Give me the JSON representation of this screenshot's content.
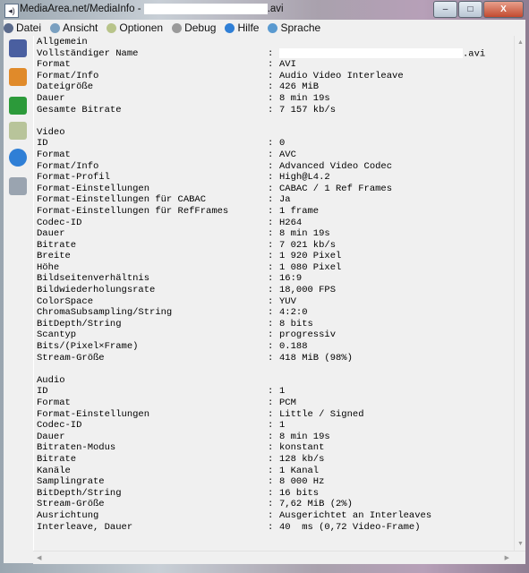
{
  "window": {
    "title_prefix": "MediaArea.net/MediaInfo - ",
    "title_suffix": ".avi",
    "minimize": "–",
    "maximize": "□",
    "close": "X"
  },
  "menu": [
    {
      "label": "Datei",
      "icon": "file-icon",
      "color": "#5b6b8c"
    },
    {
      "label": "Ansicht",
      "icon": "view-icon",
      "color": "#7aa0c0"
    },
    {
      "label": "Optionen",
      "icon": "options-icon",
      "color": "#b8c48a"
    },
    {
      "label": "Debug",
      "icon": "debug-icon",
      "color": "#9a9a9a"
    },
    {
      "label": "Hilfe",
      "icon": "info-icon",
      "color": "#2f7fd6"
    },
    {
      "label": "Sprache",
      "icon": "globe-icon",
      "color": "#5a9ad0"
    }
  ],
  "sidebar_icons": [
    "open-file-icon",
    "open-folder-icon",
    "export-icon",
    "tree-view-icon",
    "about-icon",
    "copy-icon"
  ],
  "sections": [
    {
      "title": "Allgemein",
      "rows": [
        [
          "Vollständiger Name",
          ".avi"
        ],
        [
          "Format",
          "AVI"
        ],
        [
          "Format/Info",
          "Audio Video Interleave"
        ],
        [
          "Dateigröße",
          "426 MiB"
        ],
        [
          "Dauer",
          "8 min 19s"
        ],
        [
          "Gesamte Bitrate",
          "7 157 kb/s"
        ]
      ]
    },
    {
      "title": "Video",
      "rows": [
        [
          "ID",
          "0"
        ],
        [
          "Format",
          "AVC"
        ],
        [
          "Format/Info",
          "Advanced Video Codec"
        ],
        [
          "Format-Profil",
          "High@L4.2"
        ],
        [
          "Format-Einstellungen",
          "CABAC / 1 Ref Frames"
        ],
        [
          "Format-Einstellungen für CABAC",
          "Ja"
        ],
        [
          "Format-Einstellungen für RefFrames",
          "1 frame"
        ],
        [
          "Codec-ID",
          "H264"
        ],
        [
          "Dauer",
          "8 min 19s"
        ],
        [
          "Bitrate",
          "7 021 kb/s"
        ],
        [
          "Breite",
          "1 920 Pixel"
        ],
        [
          "Höhe",
          "1 080 Pixel"
        ],
        [
          "Bildseitenverhältnis",
          "16:9"
        ],
        [
          "Bildwiederholungsrate",
          "18,000 FPS"
        ],
        [
          "ColorSpace",
          "YUV"
        ],
        [
          "ChromaSubsampling/String",
          "4:2:0"
        ],
        [
          "BitDepth/String",
          "8 bits"
        ],
        [
          "Scantyp",
          "progressiv"
        ],
        [
          "Bits/(Pixel×Frame)",
          "0.188"
        ],
        [
          "Stream-Größe",
          "418 MiB (98%)"
        ]
      ]
    },
    {
      "title": "Audio",
      "rows": [
        [
          "ID",
          "1"
        ],
        [
          "Format",
          "PCM"
        ],
        [
          "Format-Einstellungen",
          "Little / Signed"
        ],
        [
          "Codec-ID",
          "1"
        ],
        [
          "Dauer",
          "8 min 19s"
        ],
        [
          "Bitraten-Modus",
          "konstant"
        ],
        [
          "Bitrate",
          "128 kb/s"
        ],
        [
          "Kanäle",
          "1 Kanal"
        ],
        [
          "Samplingrate",
          "8 000 Hz"
        ],
        [
          "BitDepth/String",
          "16 bits"
        ],
        [
          "Stream-Größe",
          "7,62 MiB (2%)"
        ],
        [
          "Ausrichtung",
          "Ausgerichtet an Interleaves"
        ],
        [
          "Interleave, Dauer",
          "40  ms (0,72 Video-Frame)"
        ]
      ]
    }
  ]
}
